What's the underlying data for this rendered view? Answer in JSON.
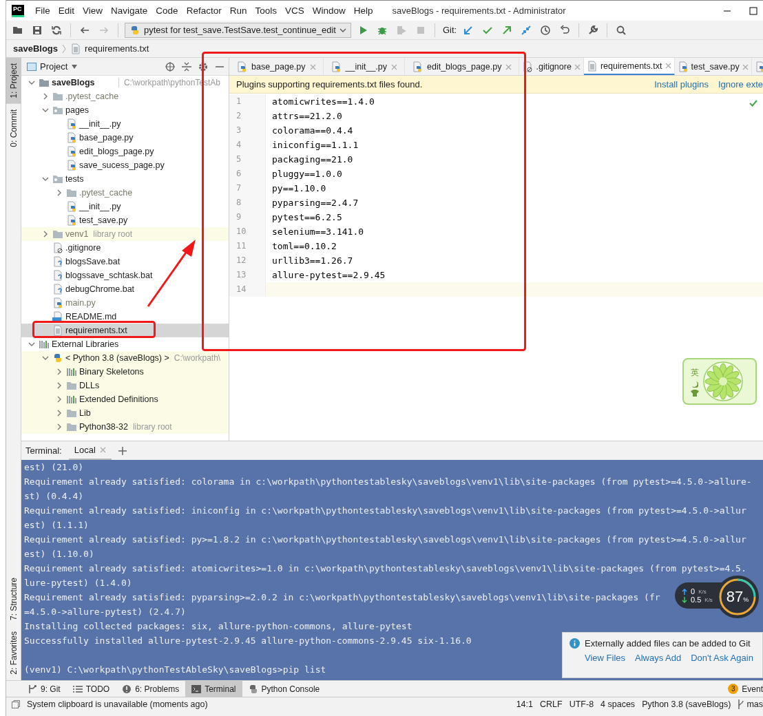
{
  "window": {
    "app_logo": "PC",
    "title": "saveBlogs - requirements.txt - Administrator"
  },
  "menu": [
    "File",
    "Edit",
    "View",
    "Navigate",
    "Code",
    "Refactor",
    "Run",
    "Tools",
    "VCS",
    "Window",
    "Help"
  ],
  "toolbar": {
    "buttons": [
      {
        "disabled": false
      },
      {
        "disabled": false
      },
      {
        "disabled": false
      },
      {
        "disabled": false
      },
      {
        "disabled": true
      }
    ],
    "run_config": "pytest for test_save.TestSave.test_continue_edit",
    "run_buttons": [
      {
        "disabled": false
      },
      {
        "disabled": false
      },
      {
        "disabled": true
      },
      {
        "disabled": true
      }
    ],
    "git_label": "Git:",
    "git_buttons": [
      {
        "disabled": false
      },
      {
        "disabled": false
      },
      {
        "disabled": false
      },
      {
        "disabled": false
      },
      {
        "disabled": false
      },
      {
        "disabled": false
      }
    ],
    "tool_buttons": [
      {
        "disabled": false
      },
      {
        "disabled": false
      }
    ]
  },
  "breadcrumb": {
    "project": "saveBlogs",
    "file": "requirements.txt"
  },
  "left_strip": {
    "top": [
      {
        "label": "1: Project",
        "selected": true
      },
      {
        "label": "0: Commit",
        "selected": false
      }
    ],
    "bottom": [
      {
        "label": "7: Structure",
        "selected": false
      },
      {
        "label": "2: Favorites",
        "selected": false
      }
    ]
  },
  "project_panel": {
    "title": "Project",
    "tree": [
      {
        "name": "saveBlogs",
        "kind": "project",
        "hint": "C:\\workpath\\pythonTestAb",
        "expanded": true,
        "selected": false,
        "children": [
          {
            "name": ".pytest_cache",
            "kind": "folder",
            "dim": true,
            "expanded": false,
            "selected": false
          },
          {
            "name": "pages",
            "kind": "package",
            "expanded": true,
            "selected": false,
            "children": [
              {
                "name": "__init__.py",
                "kind": "pyfile",
                "selected": false
              },
              {
                "name": "base_page.py",
                "kind": "pyfile",
                "selected": false
              },
              {
                "name": "edit_blogs_page.py",
                "kind": "pyfile",
                "selected": false
              },
              {
                "name": "save_sucess_page.py",
                "kind": "pyfile",
                "selected": false
              }
            ]
          },
          {
            "name": "tests",
            "kind": "package",
            "expanded": true,
            "selected": false,
            "children": [
              {
                "name": ".pytest_cache",
                "kind": "folder",
                "dim": true,
                "expanded": false,
                "selected": false
              },
              {
                "name": "__init__.py",
                "kind": "pyfile",
                "selected": false
              },
              {
                "name": "test_save.py",
                "kind": "pyfile",
                "selected": false
              }
            ]
          },
          {
            "name": "venv1",
            "kind": "folder",
            "hint": "library root",
            "library": true,
            "dim": true,
            "expanded": false,
            "selected": false
          },
          {
            "name": ".gitignore",
            "kind": "gitignore",
            "selected": false
          },
          {
            "name": "blogsSave.bat",
            "kind": "batfile",
            "selected": false
          },
          {
            "name": "blogssave_schtask.bat",
            "kind": "batfile",
            "selected": false
          },
          {
            "name": "debugChrome.bat",
            "kind": "batfile",
            "selected": false
          },
          {
            "name": "main.py",
            "kind": "pyfile",
            "dim": true,
            "selected": false
          },
          {
            "name": "README.md",
            "kind": "mdfile",
            "selected": false
          },
          {
            "name": "requirements.txt",
            "kind": "textfile",
            "selected": true
          }
        ]
      },
      {
        "name": "External Libraries",
        "kind": "libraries",
        "expanded": true,
        "selected": false,
        "children": [
          {
            "name": "< Python 3.8 (saveBlogs) >",
            "kind": "python",
            "hint": "C:\\workpath\\",
            "library": true,
            "expanded": true,
            "selected": false,
            "children": [
              {
                "name": "Binary Skeletons",
                "kind": "bars",
                "library": true,
                "expanded": false,
                "selected": false
              },
              {
                "name": "DLLs",
                "kind": "folder",
                "library": true,
                "expanded": false,
                "selected": false
              },
              {
                "name": "Extended Definitions",
                "kind": "bars",
                "library": true,
                "expanded": false,
                "selected": false
              },
              {
                "name": "Lib",
                "kind": "folder",
                "library": true,
                "expanded": false,
                "selected": false
              },
              {
                "name": "Python38-32",
                "kind": "folder",
                "hint": "library root",
                "library": true,
                "expanded": false,
                "selected": false
              }
            ]
          }
        ]
      }
    ]
  },
  "editor": {
    "tabs": [
      {
        "label": "base_page.py",
        "kind": "pyfile",
        "selected": false
      },
      {
        "label": "__init__.py",
        "kind": "pyfile",
        "selected": false
      },
      {
        "label": "edit_blogs_page.py",
        "kind": "pyfile",
        "selected": false
      },
      {
        "label": ".gitignore",
        "kind": "gitignore",
        "selected": false
      },
      {
        "label": "requirements.txt",
        "kind": "textfile",
        "selected": true
      },
      {
        "label": "test_save.py",
        "kind": "pyfile",
        "selected": false
      },
      {
        "kind": "pyfile",
        "selected": false
      }
    ],
    "banner": {
      "message": "Plugins supporting requirements.txt files found.",
      "actions": [
        "Install plugins",
        "Ignore exte"
      ]
    },
    "lines": [
      {
        "number": "1",
        "text": "atomicwrites==1.4.0",
        "current": false
      },
      {
        "number": "2",
        "text": "attrs==21.2.0",
        "current": false
      },
      {
        "number": "3",
        "text": "colorama==0.4.4",
        "current": false
      },
      {
        "number": "4",
        "text": "iniconfig==1.1.1",
        "current": false
      },
      {
        "number": "5",
        "text": "packaging==21.0",
        "current": false
      },
      {
        "number": "6",
        "text": "pluggy==1.0.0",
        "current": false
      },
      {
        "number": "7",
        "text": "py==1.10.0",
        "current": false
      },
      {
        "number": "8",
        "text": "pyparsing==2.4.7",
        "current": false
      },
      {
        "number": "9",
        "text": "pytest==6.2.5",
        "current": false
      },
      {
        "number": "10",
        "text": "selenium==3.141.0",
        "current": false
      },
      {
        "number": "11",
        "text": "toml==0.10.2",
        "current": false
      },
      {
        "number": "12",
        "text": "urllib3==1.26.7",
        "current": false
      },
      {
        "number": "13",
        "text": "allure-pytest==2.9.45",
        "current": false
      },
      {
        "number": "14",
        "current": true
      }
    ]
  },
  "terminal": {
    "label": "Terminal:",
    "tabs": [
      {
        "label": "Local",
        "selected": true
      }
    ],
    "output": [
      "est) (21.0)",
      "Requirement already satisfied: colorama in c:\\workpath\\pythontestablesky\\saveblogs\\venv1\\lib\\site-packages (from pytest>=4.5.0->allure-",
      "st) (0.4.4)",
      "Requirement already satisfied: iniconfig in c:\\workpath\\pythontestablesky\\saveblogs\\venv1\\lib\\site-packages (from pytest>=4.5.0->allur",
      "est) (1.1.1)",
      "Requirement already satisfied: py>=1.8.2 in c:\\workpath\\pythontestablesky\\saveblogs\\venv1\\lib\\site-packages (from pytest>=4.5.0->allur",
      "est) (1.10.0)",
      "Requirement already satisfied: atomicwrites>=1.0 in c:\\workpath\\pythontestablesky\\saveblogs\\venv1\\lib\\site-packages (from pytest>=4.5.",
      "lure-pytest) (1.4.0)",
      "Requirement already satisfied: pyparsing>=2.0.2 in c:\\workpath\\pythontestablesky\\saveblogs\\venv1\\lib\\site-packages (fr",
      "=4.5.0->allure-pytest) (2.4.7)",
      "Installing collected packages: six, allure-python-commons, allure-pytest",
      "Successfully installed allure-pytest-2.9.45 allure-python-commons-2.9.45 six-1.16.0"
    ],
    "prompt": "(venv1) C:\\workpath\\pythonTestAbleSky\\saveBlogs>pip list"
  },
  "tool_windows": [
    {
      "label": "9: Git",
      "selected": false
    },
    {
      "label": "TODO",
      "selected": false
    },
    {
      "label": "6: Problems",
      "selected": false
    },
    {
      "label": "Terminal",
      "selected": true
    },
    {
      "label": "Python Console",
      "selected": false
    }
  ],
  "event_log": {
    "count": "3",
    "label": "Event"
  },
  "status_bar": {
    "message": "System clipboard is unavailable (moments ago)",
    "items": [
      "14:1",
      "CRLF",
      "UTF-8",
      "4 spaces",
      "Python 3.8 (saveBlogs)"
    ],
    "branch": "mas"
  },
  "notification": {
    "message": "Externally added files can be added to Git",
    "actions": [
      "View Files",
      "Always Add",
      "Don't Ask Again"
    ]
  },
  "net_monitor": {
    "up": "0",
    "up_unit": "K/s",
    "down": "0.5",
    "down_unit": "K/s",
    "percent": "87",
    "percent_sign": "%"
  },
  "ime_widget": {
    "label": "英"
  },
  "annotations": [
    {
      "kind": "box"
    },
    {
      "kind": "box"
    },
    {
      "kind": "arrow"
    }
  ]
}
